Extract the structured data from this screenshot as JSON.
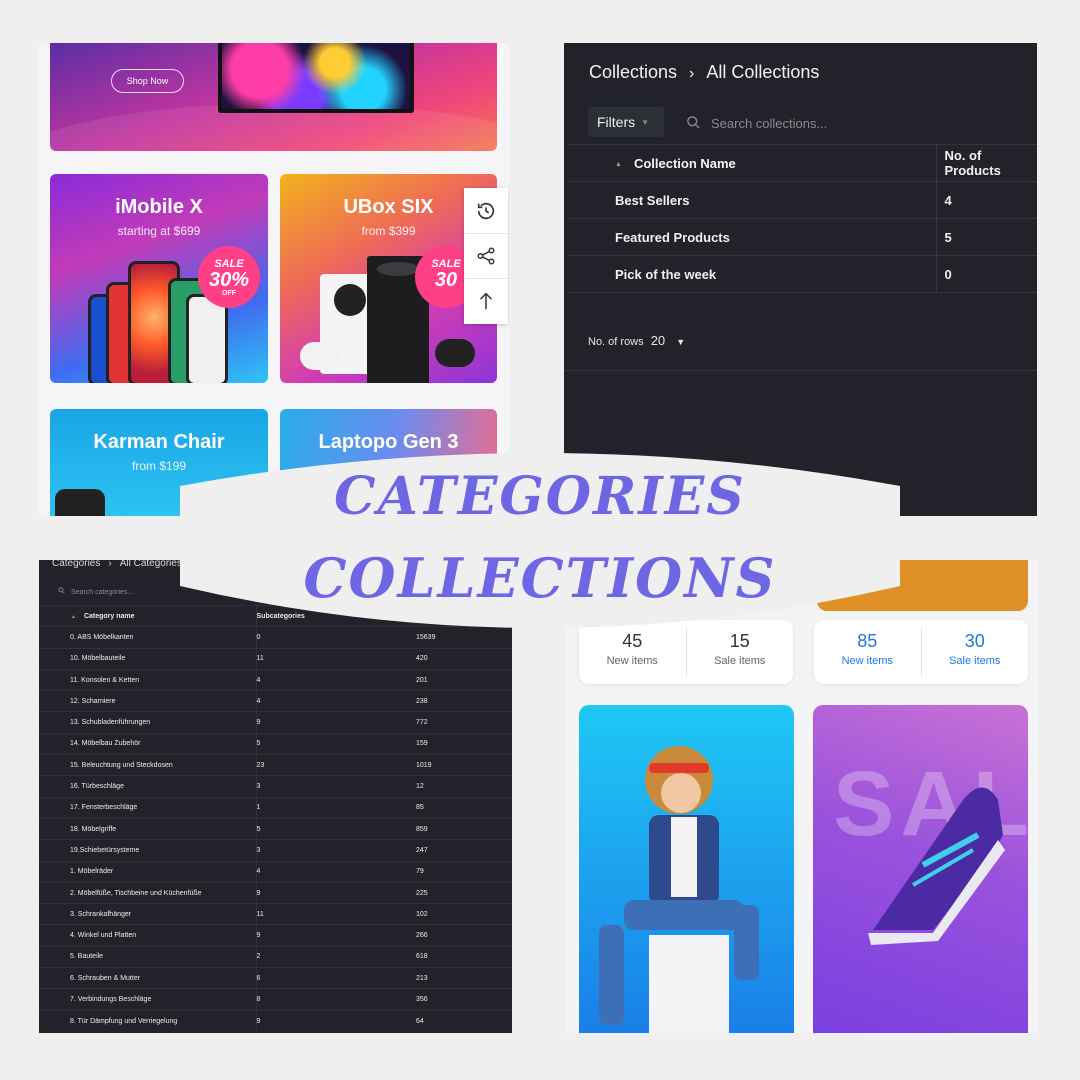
{
  "shop": {
    "hero": {
      "button_label": "Shop Now"
    },
    "cards": [
      {
        "title": "iMobile X",
        "subtitle": "starting at $699",
        "badge_top": "SALE",
        "badge_main": "30%",
        "badge_small": "OFF"
      },
      {
        "title": "UBox SIX",
        "subtitle": "from $399",
        "badge_top": "SALE",
        "badge_main": "30"
      },
      {
        "title": "Karman Chair",
        "subtitle": "from $199"
      },
      {
        "title": "Laptopo Gen 3"
      }
    ],
    "side_tools": [
      "history-icon",
      "share-icon",
      "arrow-up-icon"
    ]
  },
  "collections": {
    "breadcrumb": {
      "root": "Collections",
      "separator": "›",
      "current": "All Collections"
    },
    "filters_label": "Filters",
    "search_placeholder": "Search collections...",
    "columns": [
      "Collection Name",
      "No. of Products"
    ],
    "rows": [
      {
        "name": "Best Sellers",
        "count": "4"
      },
      {
        "name": "Featured Products",
        "count": "5"
      },
      {
        "name": "Pick of the week",
        "count": "0"
      }
    ],
    "rows_label": "No. of rows",
    "rows_value": "20"
  },
  "categories": {
    "breadcrumb": {
      "root": "Categories",
      "separator": "›",
      "current": "All Categories"
    },
    "search_placeholder": "Search categories...",
    "columns": [
      "Category name",
      "Subcategories",
      ""
    ],
    "rows": [
      {
        "name": "0. ABS Möbelkanten",
        "sub": "0",
        "products": "15639"
      },
      {
        "name": "10. Möbelbauteile",
        "sub": "11",
        "products": "420"
      },
      {
        "name": "11. Konsolen & Ketten",
        "sub": "4",
        "products": "201"
      },
      {
        "name": "12. Scharniere",
        "sub": "4",
        "products": "238"
      },
      {
        "name": "13. Schubladenführungen",
        "sub": "9",
        "products": "772"
      },
      {
        "name": "14. Möbelbau Zubehör",
        "sub": "5",
        "products": "159"
      },
      {
        "name": "15. Beleuchtung und Steckdosen",
        "sub": "23",
        "products": "1019"
      },
      {
        "name": "16. Türbeschläge",
        "sub": "3",
        "products": "12"
      },
      {
        "name": "17. Fensterbeschläge",
        "sub": "1",
        "products": "85"
      },
      {
        "name": "18. Möbelgriffe",
        "sub": "5",
        "products": "859"
      },
      {
        "name": "19.Schiebetürsysteme",
        "sub": "3",
        "products": "247"
      },
      {
        "name": "1. Möbelräder",
        "sub": "4",
        "products": "79"
      },
      {
        "name": "2. Möbelfüße, Tischbeine und Küchenfüße",
        "sub": "9",
        "products": "225"
      },
      {
        "name": "3. Schrankafhänger",
        "sub": "11",
        "products": "102"
      },
      {
        "name": "4. Winkel und Platten",
        "sub": "9",
        "products": "266"
      },
      {
        "name": "5. Bauteile",
        "sub": "2",
        "products": "618"
      },
      {
        "name": "6. Schrauben & Mutter",
        "sub": "6",
        "products": "213"
      },
      {
        "name": "7. Verbindungs Beschläge",
        "sub": "8",
        "products": "356"
      },
      {
        "name": "8. Tür Dämpfung und Verriegelung",
        "sub": "9",
        "products": "64"
      }
    ]
  },
  "stats": {
    "cards": [
      {
        "new_value": "45",
        "new_label": "New items",
        "sale_value": "15",
        "sale_label": "Sale items"
      },
      {
        "new_value": "85",
        "new_label": "New items",
        "sale_value": "30",
        "sale_label": "Sale items"
      }
    ],
    "promo_letters": "SALE"
  },
  "overlay": {
    "line1": "CATEGORIES",
    "line2": "COLLECTIONS",
    "color": "#6e66e3"
  }
}
